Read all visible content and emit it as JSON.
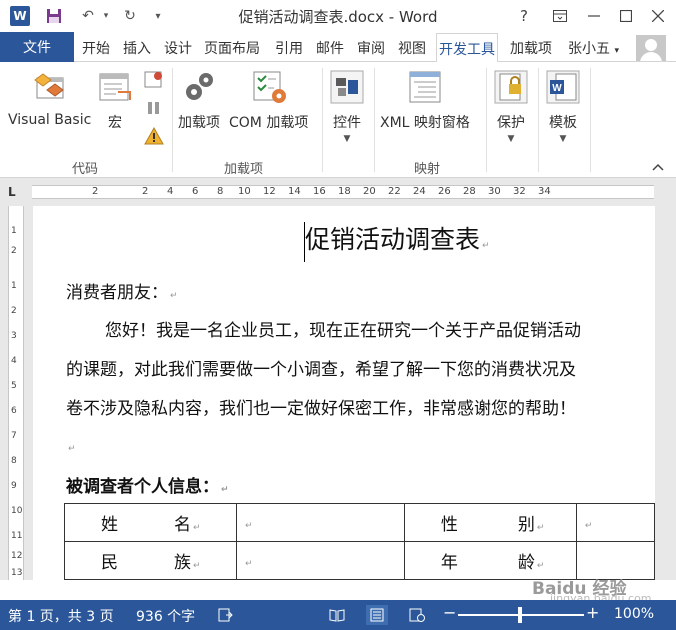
{
  "window": {
    "title": "促销活动调查表.docx - Word",
    "help": "?"
  },
  "tabs": {
    "file": "文件",
    "items": [
      "开始",
      "插入",
      "设计",
      "页面布局",
      "引用",
      "邮件",
      "审阅",
      "视图",
      "开发工具",
      "加载项"
    ],
    "active": "开发工具",
    "user": "张小五"
  },
  "ribbon": {
    "buttons": {
      "visual_basic": "Visual Basic",
      "macro": "宏",
      "addins": "加载项",
      "com_addins": "COM 加载项",
      "controls": "控件",
      "xml_mapping": "XML 映射窗格",
      "protect": "保护",
      "template": "模板"
    },
    "groups": {
      "code": "代码",
      "addins": "加载项",
      "mapping": "映射"
    }
  },
  "ruler": {
    "corner": "L",
    "h_numbers": [
      "2",
      "2",
      "4",
      "6",
      "8",
      "10",
      "12",
      "14",
      "16",
      "18",
      "20",
      "22",
      "24",
      "26",
      "28",
      "30",
      "32",
      "34"
    ],
    "v_numbers": [
      "1",
      "2",
      "1",
      "2",
      "3",
      "4",
      "5",
      "6",
      "7",
      "8",
      "9",
      "10",
      "11",
      "12",
      "13"
    ]
  },
  "document": {
    "title": "促销活动调查表",
    "greeting": "消费者朋友：",
    "para1": "您好！我是一名企业员工，现在正在研究一个关于产品促销活动",
    "para2": "的课题，对此我们需要做一个小调查，希望了解一下您的消费状况及",
    "para3": "卷不涉及隐私内容，我们也一定做好保密工作，非常感谢您的帮助！",
    "section": "被调查者个人信息：",
    "table": {
      "r1c1a": "姓",
      "r1c1b": "名",
      "r1c3a": "性",
      "r1c3b": "别",
      "r2c1a": "民",
      "r2c1b": "族",
      "r2c3a": "年",
      "r2c3b": "龄"
    },
    "para_mark": "↵"
  },
  "status": {
    "page": "第 1 页，共 3 页",
    "words": "936 个字",
    "zoom": "100%",
    "zoom_minus": "−",
    "zoom_plus": "+"
  },
  "watermark": {
    "brand": "Baidu 经验",
    "site": "jingyan.baidu.com"
  }
}
